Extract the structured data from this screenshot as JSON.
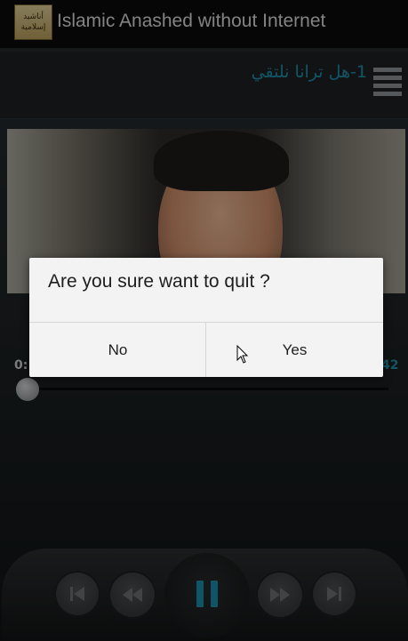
{
  "app_bar": {
    "icon_text_line1": "أناشيد",
    "icon_text_line2": "إسلامية",
    "title": "Islamic Anashed without Internet"
  },
  "player": {
    "track_title": "1-هل ترانا نلتقي",
    "time_elapsed": "0:",
    "time_total": "42",
    "progress": 0.0
  },
  "dialog": {
    "message": "Are you sure want to quit ?",
    "no_label": "No",
    "yes_label": "Yes"
  },
  "icons": {
    "menu": "menu-icon",
    "prev": "skip-previous-icon",
    "rewind": "rewind-icon",
    "pause": "pause-icon",
    "forward": "fast-forward-icon",
    "next": "skip-next-icon"
  },
  "colors": {
    "accent": "#1f8aa3",
    "dialog_bg": "#f3f3f3"
  }
}
